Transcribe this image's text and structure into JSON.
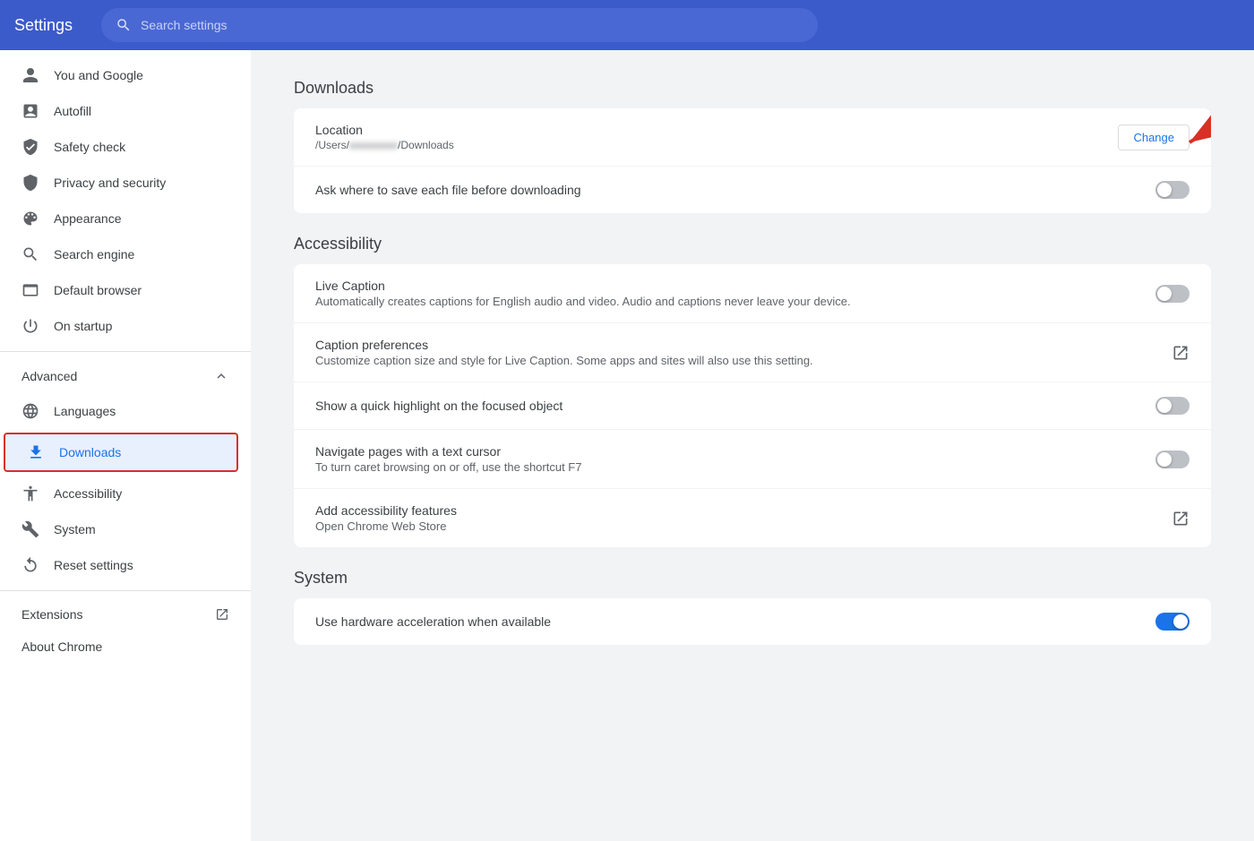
{
  "header": {
    "title": "Settings",
    "search_placeholder": "Search settings"
  },
  "sidebar": {
    "top_items": [
      {
        "id": "you-and-google",
        "label": "You and Google",
        "icon": "person"
      },
      {
        "id": "autofill",
        "label": "Autofill",
        "icon": "autofill"
      },
      {
        "id": "safety-check",
        "label": "Safety check",
        "icon": "shield-check"
      },
      {
        "id": "privacy-security",
        "label": "Privacy and security",
        "icon": "shield"
      },
      {
        "id": "appearance",
        "label": "Appearance",
        "icon": "palette"
      },
      {
        "id": "search-engine",
        "label": "Search engine",
        "icon": "search"
      },
      {
        "id": "default-browser",
        "label": "Default browser",
        "icon": "browser"
      },
      {
        "id": "on-startup",
        "label": "On startup",
        "icon": "power"
      }
    ],
    "advanced_label": "Advanced",
    "advanced_items": [
      {
        "id": "languages",
        "label": "Languages",
        "icon": "globe"
      },
      {
        "id": "downloads",
        "label": "Downloads",
        "icon": "download",
        "active": true
      },
      {
        "id": "accessibility",
        "label": "Accessibility",
        "icon": "accessibility"
      },
      {
        "id": "system",
        "label": "System",
        "icon": "wrench"
      },
      {
        "id": "reset-settings",
        "label": "Reset settings",
        "icon": "reset"
      }
    ],
    "extensions_label": "Extensions",
    "about_chrome_label": "About Chrome"
  },
  "downloads_section": {
    "title": "Downloads",
    "location_label": "Location",
    "location_path": "/Users/",
    "location_path_blurred": "username",
    "location_path_end": "/Downloads",
    "change_button_label": "Change",
    "ask_where_label": "Ask where to save each file before downloading",
    "ask_where_toggle": false
  },
  "accessibility_section": {
    "title": "Accessibility",
    "live_caption_label": "Live Caption",
    "live_caption_desc": "Automatically creates captions for English audio and video. Audio and captions never leave your device.",
    "live_caption_toggle": false,
    "caption_prefs_label": "Caption preferences",
    "caption_prefs_desc": "Customize caption size and style for Live Caption. Some apps and sites will also use this setting.",
    "highlight_label": "Show a quick highlight on the focused object",
    "highlight_toggle": false,
    "text_cursor_label": "Navigate pages with a text cursor",
    "text_cursor_desc": "To turn caret browsing on or off, use the shortcut F7",
    "text_cursor_toggle": false,
    "add_features_label": "Add accessibility features",
    "add_features_desc": "Open Chrome Web Store"
  },
  "system_section": {
    "title": "System",
    "hardware_accel_label": "Use hardware acceleration when available",
    "hardware_accel_toggle": true
  }
}
